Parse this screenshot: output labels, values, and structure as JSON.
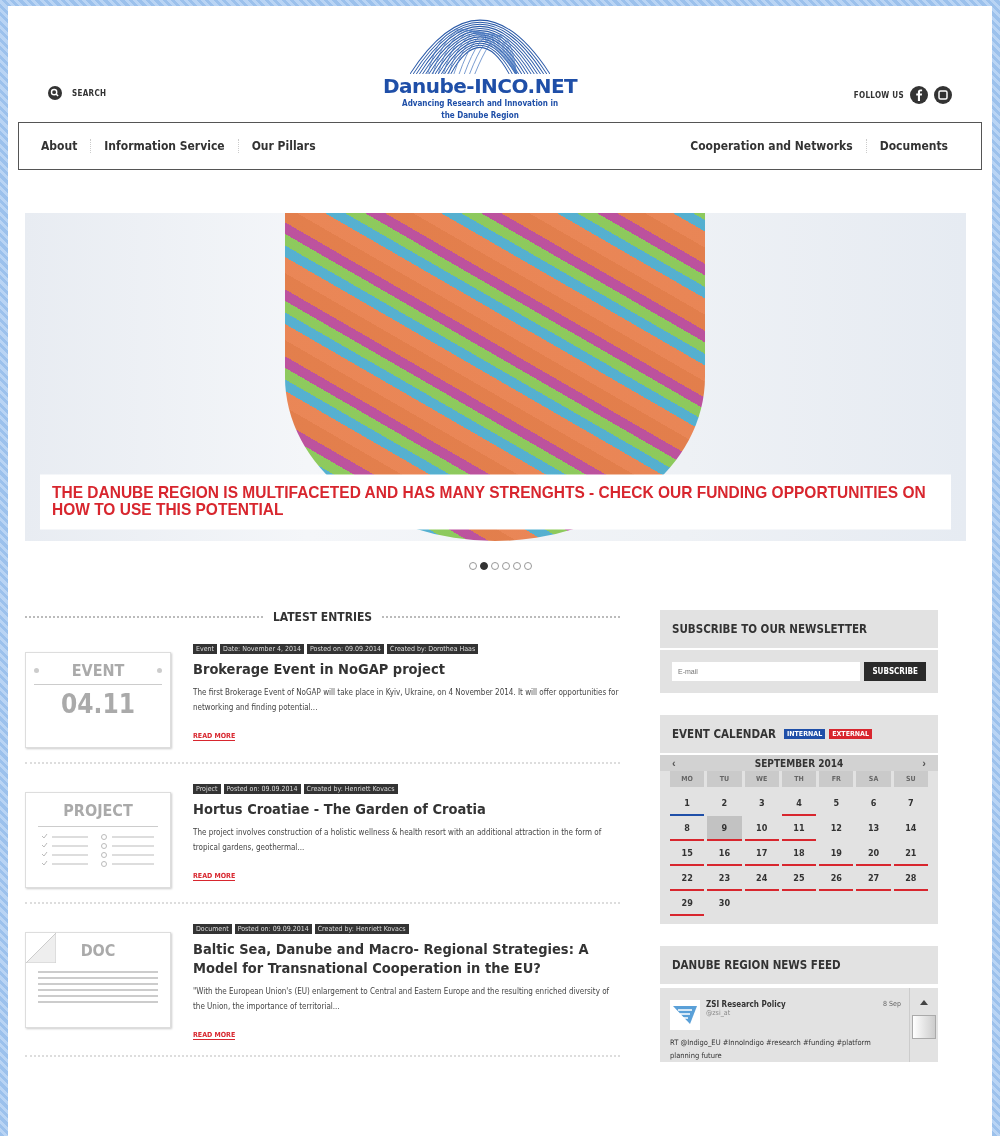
{
  "header": {
    "search": "SEARCH",
    "follow": "FOLLOW US",
    "logo_title": "Danube-INCO.NET",
    "logo_subtitle": "Advancing Research and Innovation in the Danube Region",
    "nav_left": [
      "About",
      "Information Service",
      "Our Pillars"
    ],
    "nav_right": [
      "Cooperation and Networks",
      "Documents"
    ]
  },
  "hero": {
    "caption": "THE DANUBE REGION IS MULTIFACETED AND HAS MANY STRENGHTS - CHECK OUR FUNDING OPPORTUNITIES ON HOW TO USE THIS POTENTIAL",
    "dots": [
      {
        "selected": false
      },
      {
        "selected": true
      },
      {
        "selected": false
      },
      {
        "selected": false
      },
      {
        "selected": false
      },
      {
        "selected": false
      }
    ]
  },
  "latest": {
    "heading": "LATEST ENTRIES",
    "entries": [
      {
        "kind": "event",
        "badge": "EVENT",
        "date": "04.11",
        "tags": [
          "Event",
          "Date: November 4, 2014",
          "Posted on: 09.09.2014",
          "Created by: Dorothea Haas"
        ],
        "title": "Brokerage Event in NoGAP project",
        "text": "The first Brokerage Event of NoGAP will take place in Kyiv, Ukraine, on 4 November 2014. It will offer opportunities for networking and finding potential...",
        "read_more": "READ MORE"
      },
      {
        "kind": "project",
        "badge": "PROJECT",
        "tags": [
          "Project",
          "Posted on: 09.09.2014",
          "Created by: Henriett Kovacs"
        ],
        "title": "Hortus Croatiae - The Garden of Croatia",
        "text": "The project involves construction of a holistic wellness & health resort with an additional attraction in the form of tropical gardens, geothermal...",
        "read_more": "READ MORE"
      },
      {
        "kind": "doc",
        "badge": "DOC",
        "tags": [
          "Document",
          "Posted on: 09.09.2014",
          "Created by: Henriett Kovacs"
        ],
        "title": "Baltic Sea, Danube and Macro- Regional Strategies: A Model for Transnational Cooperation in the EU?",
        "text": "\"With the European Union's (EU) enlargement to Central and Eastern Europe and the resulting enriched diversity of the Union, the importance of territorial...",
        "read_more": "READ MORE"
      }
    ]
  },
  "newsletter": {
    "title": "SUBSCRIBE TO OUR NEWSLETTER",
    "placeholder": "E-mail",
    "button": "SUBSCRIBE"
  },
  "calendar": {
    "title": "EVENT CALENDAR",
    "legend": [
      {
        "label": "INTERNAL",
        "color": "#1f4fa8"
      },
      {
        "label": "EXTERNAL",
        "color": "#d8262e"
      }
    ],
    "month": "SEPTEMBER 2014",
    "prev": "‹",
    "next": "›",
    "weekdays": [
      "MO",
      "TU",
      "WE",
      "TH",
      "FR",
      "SA",
      "SU"
    ],
    "days": [
      {
        "label": "1",
        "selected": false,
        "color": "#1f4fa8"
      },
      {
        "label": "2",
        "selected": false
      },
      {
        "label": "3",
        "selected": false
      },
      {
        "label": "4",
        "selected": false,
        "color": "#d8262e"
      },
      {
        "label": "5",
        "selected": false
      },
      {
        "label": "6",
        "selected": false
      },
      {
        "label": "7",
        "selected": false
      },
      {
        "label": "8",
        "selected": false,
        "color": "#d8262e"
      },
      {
        "label": "9",
        "selected": true,
        "color": "#d8262e"
      },
      {
        "label": "10",
        "selected": false,
        "color": "#d8262e"
      },
      {
        "label": "11",
        "selected": false,
        "color": "#d8262e"
      },
      {
        "label": "12",
        "selected": false
      },
      {
        "label": "13",
        "selected": false
      },
      {
        "label": "14",
        "selected": false
      },
      {
        "label": "15",
        "selected": false,
        "color": "#d8262e"
      },
      {
        "label": "16",
        "selected": false,
        "color": "#d8262e"
      },
      {
        "label": "17",
        "selected": false,
        "color": "#d8262e"
      },
      {
        "label": "18",
        "selected": false,
        "color": "#d8262e"
      },
      {
        "label": "19",
        "selected": false,
        "color": "#d8262e"
      },
      {
        "label": "20",
        "selected": false,
        "color": "#d8262e"
      },
      {
        "label": "21",
        "selected": false,
        "color": "#d8262e"
      },
      {
        "label": "22",
        "selected": false,
        "color": "#d8262e"
      },
      {
        "label": "23",
        "selected": false,
        "color": "#d8262e"
      },
      {
        "label": "24",
        "selected": false,
        "color": "#d8262e"
      },
      {
        "label": "25",
        "selected": false,
        "color": "#d8262e"
      },
      {
        "label": "26",
        "selected": false,
        "color": "#d8262e"
      },
      {
        "label": "27",
        "selected": false,
        "color": "#d8262e"
      },
      {
        "label": "28",
        "selected": false,
        "color": "#d8262e"
      },
      {
        "label": "29",
        "selected": false,
        "color": "#d8262e"
      },
      {
        "label": "30",
        "selected": false
      }
    ]
  },
  "news_feed": {
    "title": "DANUBE REGION NEWS FEED",
    "tweet": {
      "author": "ZSI Research Policy",
      "handle": "@zsi_at",
      "time": "8 Sep",
      "text": "RT @Indigo_EU #InnoIndigo #research #funding #platform planning future"
    }
  }
}
